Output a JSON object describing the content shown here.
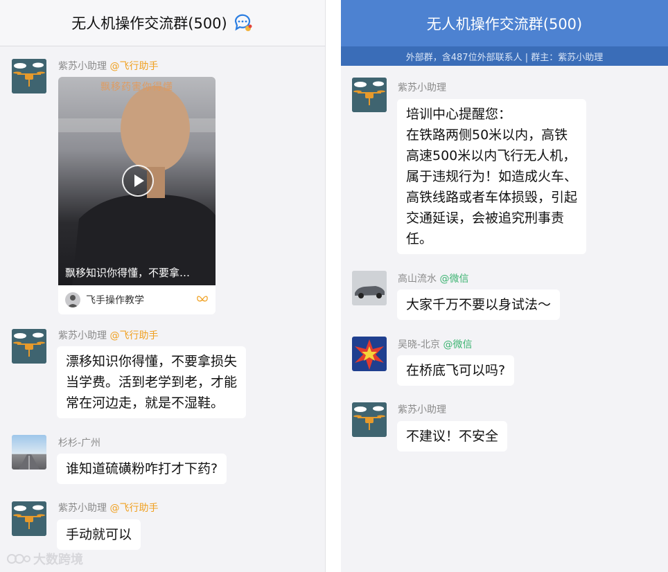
{
  "left": {
    "header": {
      "title": "无人机操作交流群(500)",
      "icon": "chat-bubbles-icon"
    },
    "messages": [
      {
        "sender": "紫苏小助理",
        "tag": "@飞行助手",
        "avatar": "drone-avatar",
        "video": {
          "watermark": "飘移药害你得懂",
          "caption": "飘移知识你得懂，不要拿…",
          "channel": "飞手操作教学",
          "channel_logo": "butterfly-icon"
        }
      },
      {
        "sender": "紫苏小助理",
        "tag": "@飞行助手",
        "avatar": "drone-avatar",
        "lines": [
          "漂移知识你得懂，不要拿损失",
          "当学费。活到老学到老，才能",
          "常在河边走，就是不湿鞋。"
        ]
      },
      {
        "sender": "杉杉-广州",
        "tag": "",
        "avatar": "road-avatar",
        "lines": [
          "谁知道硫磺粉咋打才下药?"
        ]
      },
      {
        "sender": "紫苏小助理",
        "tag": "@飞行助手",
        "avatar": "drone-avatar",
        "lines": [
          "手动就可以"
        ]
      }
    ]
  },
  "right": {
    "header": {
      "title": "无人机操作交流群(500)",
      "subtitle": "外部群，含487位外部联系人 | 群主：紫苏小助理"
    },
    "messages": [
      {
        "sender": "紫苏小助理",
        "tag": "",
        "avatar": "drone-avatar",
        "lines": [
          "培训中心提醒您：",
          "在铁路两侧50米以内，高铁",
          "高速500米以内飞行无人机，",
          "属于违规行为！如造成火车、",
          "高铁线路或者车体损毁，引起",
          "交通延误，会被追究刑事责",
          "任。"
        ]
      },
      {
        "sender": "高山流水",
        "tag": "@微信",
        "avatar": "car-avatar",
        "lines": [
          "大家千万不要以身试法～"
        ]
      },
      {
        "sender": "吴晓-北京",
        "tag": "@微信",
        "avatar": "comic-avatar",
        "lines": [
          "在桥底飞可以吗?"
        ]
      },
      {
        "sender": "紫苏小助理",
        "tag": "",
        "avatar": "drone-avatar",
        "lines": [
          "不建议！不安全"
        ]
      }
    ]
  },
  "watermark": {
    "text": "大数跨境"
  },
  "colors": {
    "accent_blue": "#4d82d1",
    "tag_orange": "#f0a020",
    "tag_green": "#3cb371"
  }
}
